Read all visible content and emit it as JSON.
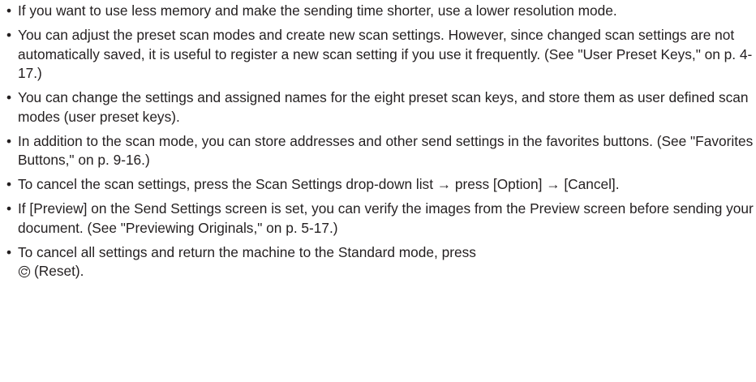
{
  "bullet_glyph": "•",
  "notes": [
    {
      "text": "If you want to use less memory and make the sending time shorter, use a lower resolution mode."
    },
    {
      "text": "You can adjust the preset scan modes and create new scan settings. However, since changed scan settings are not automatically saved, it is useful to register a new scan setting if you use it frequently. (See \"User Preset Keys,\" on p. 4-17.)"
    },
    {
      "text": "You can change the settings and assigned names for the eight preset scan keys, and store them as user defined scan modes (user preset keys)."
    },
    {
      "text": "In addition to the scan mode, you can store addresses and other send settings in the favorites buttons. (See \"Favorites Buttons,\" on p. 9-16.)"
    },
    {
      "text": "To cancel the scan settings, press the Scan Settings drop-down list → press [Option] → [Cancel]."
    },
    {
      "text": "If [Preview] on the Send Settings screen is set, you can verify the images from the Preview screen before sending your document. (See \"Previewing Originals,\" on p. 5-17.)"
    },
    {
      "text_before_break": "To cancel all settings and return the machine to the Standard mode, press",
      "icon": "reset-icon",
      "text_after_icon": "(Reset)."
    }
  ]
}
